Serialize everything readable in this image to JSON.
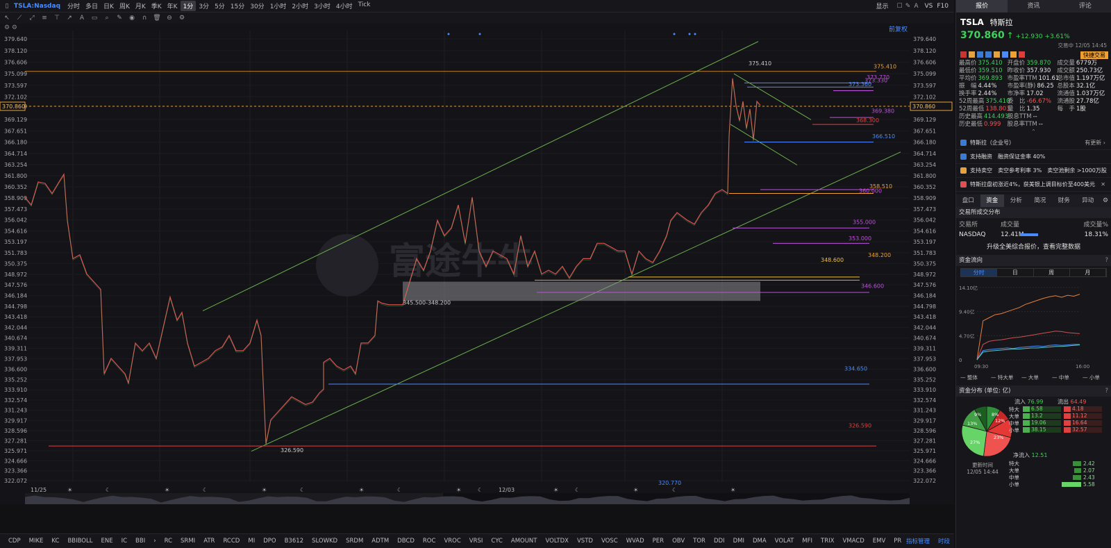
{
  "topbar": {
    "symbol": "TSLA:Nasdaq",
    "timeframes": [
      "分时",
      "多日",
      "日K",
      "周K",
      "月K",
      "季K",
      "年K",
      "1分",
      "3分",
      "5分",
      "15分",
      "30分",
      "1小时",
      "2小时",
      "3小时",
      "4小时",
      "Tick"
    ],
    "active_timeframe": "1分",
    "right_items": [
      "显示",
      "VS",
      "F10"
    ]
  },
  "chart": {
    "adjust_label": "前复权",
    "price_axis": [
      "379.640",
      "378.120",
      "376.606",
      "375.099",
      "373.597",
      "372.102",
      "370.860",
      "369.129",
      "367.651",
      "366.180",
      "364.714",
      "363.254",
      "361.800",
      "360.352",
      "358.909",
      "357.473",
      "356.042",
      "354.616",
      "353.197",
      "351.783",
      "350.375",
      "348.972",
      "347.576",
      "346.184",
      "344.798",
      "343.418",
      "342.044",
      "340.674",
      "339.311",
      "337.953",
      "336.600",
      "335.252",
      "333.910",
      "332.574",
      "331.243",
      "329.917",
      "328.596",
      "327.281",
      "325.971",
      "324.666",
      "323.366",
      "322.072"
    ],
    "current_price": "370.860",
    "date_labels": [
      "11/25",
      "12/03"
    ],
    "annotations": {
      "high": "375.410",
      "low": "326.590",
      "zone": "345.500-348.200",
      "bottom_marker": "320.770"
    },
    "level_labels": [
      {
        "text": "375.410",
        "color": "#f0a030"
      },
      {
        "text": "373.770",
        "color": "#c050e0"
      },
      {
        "text": "373.330",
        "color": "#c050e0"
      },
      {
        "text": "373.360",
        "color": "#4a8cff"
      },
      {
        "text": "369.380",
        "color": "#c050e0"
      },
      {
        "text": "368.300",
        "color": "#e04040"
      },
      {
        "text": "366.510",
        "color": "#4a8cff"
      },
      {
        "text": "358.510",
        "color": "#f0a030"
      },
      {
        "text": "360.000",
        "color": "#c050e0"
      },
      {
        "text": "355.000",
        "color": "#c050e0"
      },
      {
        "text": "353.000",
        "color": "#c050e0"
      },
      {
        "text": "348.600",
        "color": "#f0c040"
      },
      {
        "text": "348.200",
        "color": "#f0a030"
      },
      {
        "text": "346.600",
        "color": "#c050e0"
      },
      {
        "text": "334.650",
        "color": "#4a8cff"
      },
      {
        "text": "326.590",
        "color": "#e04040"
      }
    ],
    "watermark": "富途牛牛"
  },
  "indicators": [
    "CDP",
    "MIKE",
    "KC",
    "BBIBOLL",
    "ENE",
    "IC",
    "BBI",
    "›",
    "RC",
    "SRMI",
    "ATR",
    "RCCD",
    "MI",
    "DPO",
    "B3612",
    "SLOWKD",
    "SRDM",
    "ADTM",
    "DBCD",
    "ROC",
    "VROC",
    "VRSI",
    "CYC",
    "AMOUNT",
    "VOLTDX",
    "VSTD",
    "VOSC",
    "WVAD",
    "PER",
    "OBV",
    "TOR",
    "DDI",
    "DMI",
    "DMA",
    "VOLAT",
    "MFI",
    "TRIX",
    "VMACD",
    "EMV",
    "PRICEOSC",
    "IV",
    "CCI",
    "MTM",
    "›"
  ],
  "indicator_manage": "指标管理",
  "indicator_time": "时段",
  "panel": {
    "tabs": [
      "报价",
      "资讯",
      "评论"
    ],
    "ticker": "TSLA",
    "name": "特斯拉",
    "price": "370.860",
    "change": "+12.930",
    "change_pct": "+3.61%",
    "trade_time": "交易中 12/05 14:45",
    "quick_trade": "快捷交易",
    "quote_rows": [
      [
        [
          "最高价",
          "375.410",
          "green"
        ],
        [
          "开盘价",
          "359.870",
          "green"
        ],
        [
          "成交量",
          "6779万",
          "white"
        ]
      ],
      [
        [
          "最低价",
          "359.510",
          "green"
        ],
        [
          "昨收价",
          "357.930",
          "white"
        ],
        [
          "成交额",
          "250.73亿",
          "white"
        ]
      ],
      [
        [
          "平均价",
          "369.893",
          "green"
        ],
        [
          "市盈率TTM",
          "101.61",
          "white"
        ],
        [
          "总市值",
          "1.197万亿",
          "white"
        ]
      ],
      [
        [
          "振　幅",
          "4.44%",
          "white"
        ],
        [
          "市盈率(静)",
          "86.25",
          "white"
        ],
        [
          "总股本",
          "32.1亿",
          "white"
        ]
      ],
      [
        [
          "换手率",
          "2.44%",
          "white"
        ],
        [
          "市净率",
          "17.02",
          "white"
        ],
        [
          "流通值",
          "1.037万亿",
          "white"
        ]
      ],
      [
        [
          "52周最高",
          "375.410",
          "green"
        ],
        [
          "委　比",
          "-66.67%",
          "red"
        ],
        [
          "流通股",
          "27.78亿",
          "white"
        ]
      ],
      [
        [
          "52周最低",
          "138.803",
          "red"
        ],
        [
          "量　比",
          "1.35",
          "white"
        ],
        [
          "每　手",
          "1股",
          "white"
        ]
      ],
      [
        [
          "历史最高",
          "414.493",
          "green"
        ],
        [
          "股息TTM",
          "--",
          "white"
        ],
        [
          "",
          "",
          ""
        ]
      ],
      [
        [
          "历史最低",
          "0.999",
          "red"
        ],
        [
          "股息率TTM",
          "--",
          "white"
        ],
        [
          "",
          "",
          ""
        ]
      ]
    ],
    "feed": [
      {
        "text": "特斯拉（企业号）",
        "extra": "有更新 ›"
      },
      {
        "text": "支持融资　融资保证金率 40%",
        "extra": ""
      },
      {
        "text": "支持卖空　卖空参考利率 3%　卖空池剩余 >1000万股",
        "extra": ""
      },
      {
        "text": "特斯拉盘初涨近4%，获美银上调目标价至400美元",
        "extra": "✕"
      }
    ],
    "sub_tabs": [
      "盘口",
      "资金",
      "分析",
      "简况",
      "财务",
      "异动"
    ],
    "active_sub_tab": "资金",
    "exchange_hdr": "交易所成交分布",
    "exchange_cols": [
      "交易所",
      "成交量",
      "成交量%"
    ],
    "exchange_row": {
      "name": "NASDAQ",
      "vol": "12.41M",
      "pct": "18.31%"
    },
    "upgrade_text": "升级全美综合报价，查看完整数据",
    "flow_hdr": "资金流向",
    "flow_tabs": [
      "分时",
      "日",
      "周",
      "月"
    ],
    "flow_y": [
      "14.10亿",
      "9.40亿",
      "4.70亿",
      "0"
    ],
    "flow_x": [
      "09:30",
      "16:00"
    ],
    "flow_legend": [
      "整体",
      "特大单",
      "大单",
      "中单",
      "小单"
    ],
    "dist_hdr": "资金分布 (单位: 亿)",
    "inflow_label": "流入",
    "inflow": "76.99",
    "outflow_label": "流出",
    "outflow": "64.49",
    "dist_rows": [
      {
        "name": "特大",
        "in": "6.58",
        "out": "4.18"
      },
      {
        "name": "大单",
        "in": "13.2",
        "out": "11.12"
      },
      {
        "name": "中单",
        "in": "19.06",
        "out": "16.64"
      },
      {
        "name": "小单",
        "in": "38.15",
        "out": "32.57"
      }
    ],
    "pie_labels": [
      "9%",
      "8%",
      "12%",
      "13%",
      "27%",
      "23%"
    ],
    "update_label": "更新时间",
    "update_time": "12/05 14:44",
    "net_label": "净流入",
    "net_value": "12.51",
    "net_rows": [
      {
        "name": "特大",
        "value": "2.42"
      },
      {
        "name": "大单",
        "value": "2.07"
      },
      {
        "name": "中单",
        "value": "2.43"
      },
      {
        "name": "小单",
        "value": "5.58"
      }
    ]
  }
}
